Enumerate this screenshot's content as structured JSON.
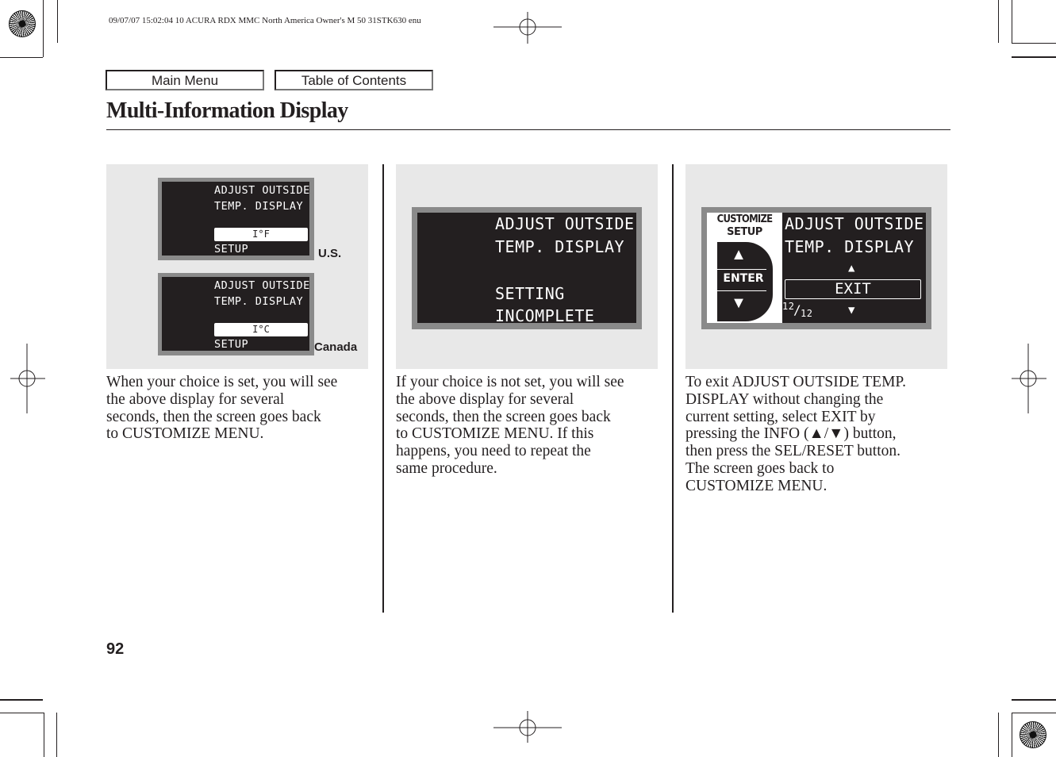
{
  "header": {
    "meta_line": "09/07/07 15:02:04    10 ACURA RDX MMC North America Owner's M 50 31STK630 enu"
  },
  "nav": {
    "main_menu_label": "Main Menu",
    "toc_label": "Table of Contents"
  },
  "page": {
    "title": "Multi-Information Display",
    "number": "92"
  },
  "columns": [
    {
      "displays": [
        {
          "line1": "ADJUST OUTSIDE",
          "line2": "TEMP. DISPLAY",
          "value_box": "I°F",
          "footer": "SETUP",
          "region_label": "U.S."
        },
        {
          "line1": "ADJUST OUTSIDE",
          "line2": "TEMP. DISPLAY",
          "value_box": "I°C",
          "footer": "SETUP",
          "region_label": "Canada"
        }
      ],
      "caption_lines": [
        "When your choice is set, you will see",
        "the above display for several",
        "seconds, then the screen goes back",
        "to CUSTOMIZE MENU."
      ]
    },
    {
      "display": {
        "line1": "ADJUST OUTSIDE",
        "line2": "TEMP. DISPLAY",
        "line3": "SETTING",
        "line4": "INCOMPLETE"
      },
      "caption_lines": [
        "If your choice is not set, you will see",
        "the above display for several",
        "seconds, then the screen goes back",
        "to CUSTOMIZE MENU. If this",
        "happens, you need to repeat the",
        "same procedure."
      ]
    },
    {
      "display": {
        "side_title1": "CUSTOMIZE",
        "side_title2": "SETUP",
        "side_enter": "ENTER",
        "side_up_icon": "▲",
        "side_down_icon": "▼",
        "line1": "ADJUST OUTSIDE",
        "line2": "TEMP. DISPLAY",
        "up_icon": "▲",
        "selected_item": "EXIT",
        "down_icon": "▼",
        "page_current": "12",
        "page_total": "12"
      },
      "caption_lines": [
        "To exit ADJUST OUTSIDE TEMP.",
        "DISPLAY without changing the",
        "current setting, select EXIT by",
        "pressing the INFO (▲/▼) button,",
        "then press the SEL/RESET button.",
        "The screen goes back to",
        "CUSTOMIZE MENU."
      ]
    }
  ]
}
